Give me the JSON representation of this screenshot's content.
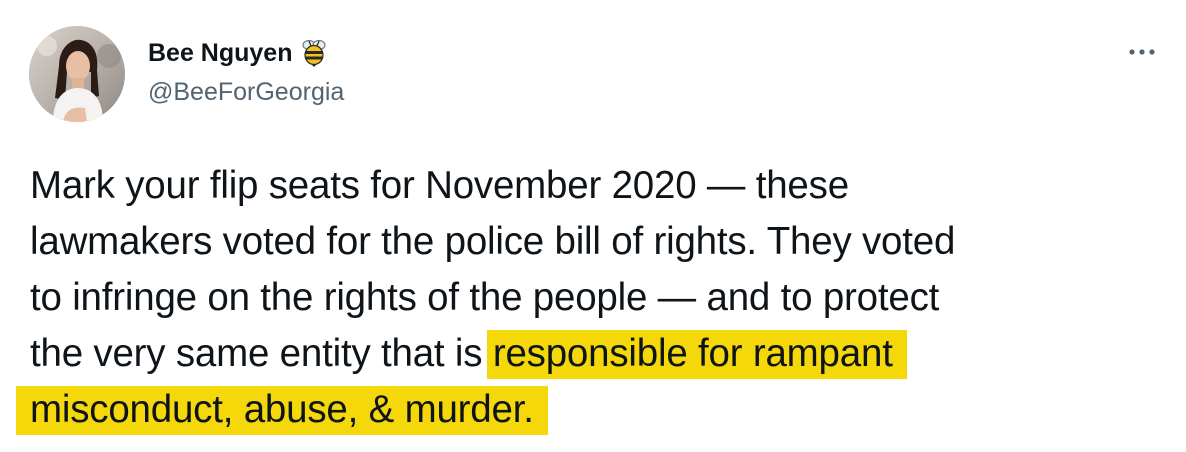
{
  "author": {
    "display_name": "Bee Nguyen",
    "emoji": "bee-icon",
    "handle": "@BeeForGeorgia",
    "avatar": "profile-photo-avatar"
  },
  "menu": {
    "icon": "more-options-icon"
  },
  "tweet": {
    "line1": "Mark your flip seats for November 2020 — these",
    "line2": "lawmakers voted for the police bill of rights. They voted",
    "line3": "to infringe on the rights of the people — and to protect",
    "line4_plain": "the very same entity that is ",
    "line4_highlight": "responsible for rampant",
    "line5_highlight": "misconduct, abuse, & murder."
  },
  "colors": {
    "text": "#0f1419",
    "secondary_text": "#536471",
    "highlight": "#f4d80a",
    "background": "#ffffff"
  }
}
